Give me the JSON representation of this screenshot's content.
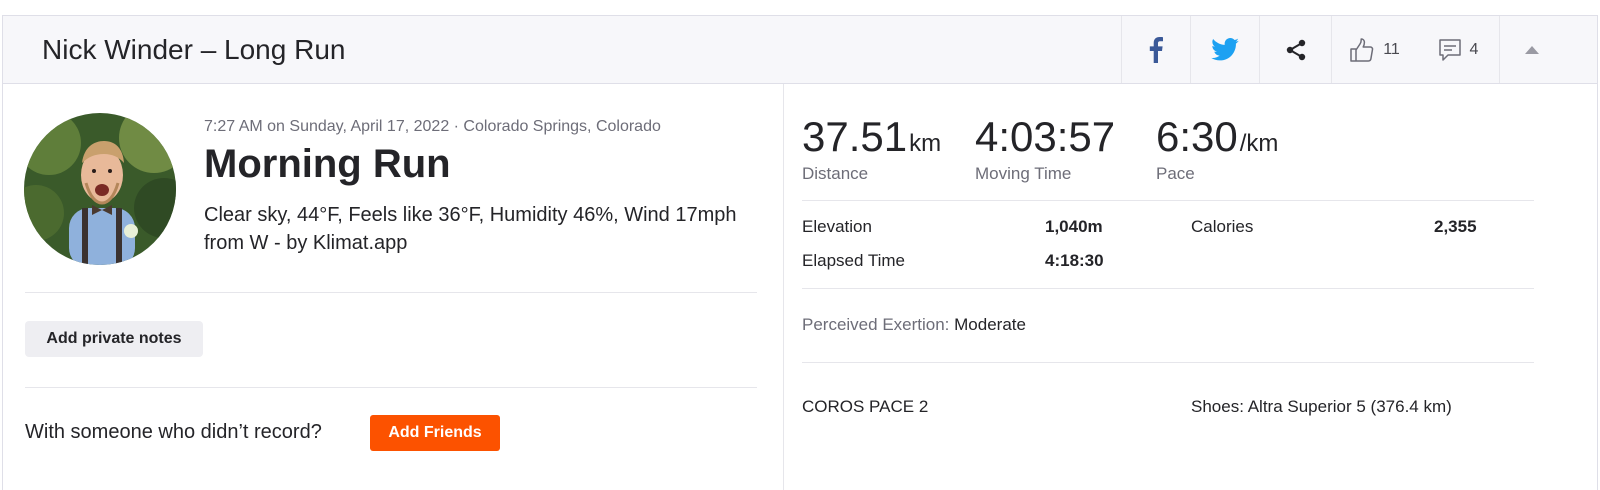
{
  "header": {
    "title": "Nick Winder – Long Run",
    "kudos_count": "11",
    "comment_count": "4"
  },
  "activity": {
    "meta": "7:27 AM on Sunday, April 17, 2022 · Colorado Springs, Colorado",
    "title": "Morning Run",
    "description": "Clear sky, 44°F, Feels like 36°F, Humidity 46%, Wind 17mph from W - by Klimat.app"
  },
  "left_actions": {
    "notes_label": "Add private notes",
    "friends_question": "With someone who didn’t record?",
    "friends_label": "Add Friends"
  },
  "stats": {
    "distance": {
      "value": "37.51",
      "unit": "km",
      "label": "Distance"
    },
    "moving_time": {
      "value": "4:03:57",
      "label": "Moving Time"
    },
    "pace": {
      "value": "6:30",
      "unit": "/km",
      "label": "Pace"
    }
  },
  "details": {
    "elevation_label": "Elevation",
    "elevation_value": "1,040m",
    "calories_label": "Calories",
    "calories_value": "2,355",
    "elapsed_label": "Elapsed Time",
    "elapsed_value": "4:18:30"
  },
  "exertion": {
    "label": "Perceived Exertion:",
    "value": "Moderate"
  },
  "gear": {
    "device": "COROS PACE 2",
    "shoes": "Shoes: Altra Superior 5 (376.4 km)"
  },
  "colors": {
    "accent": "#fc5200",
    "facebook": "#3b5998",
    "twitter": "#1da1f2"
  },
  "icons": [
    "facebook-icon",
    "twitter-icon",
    "share-icon",
    "thumbs-up-icon",
    "comment-icon",
    "chevron-up-icon"
  ]
}
